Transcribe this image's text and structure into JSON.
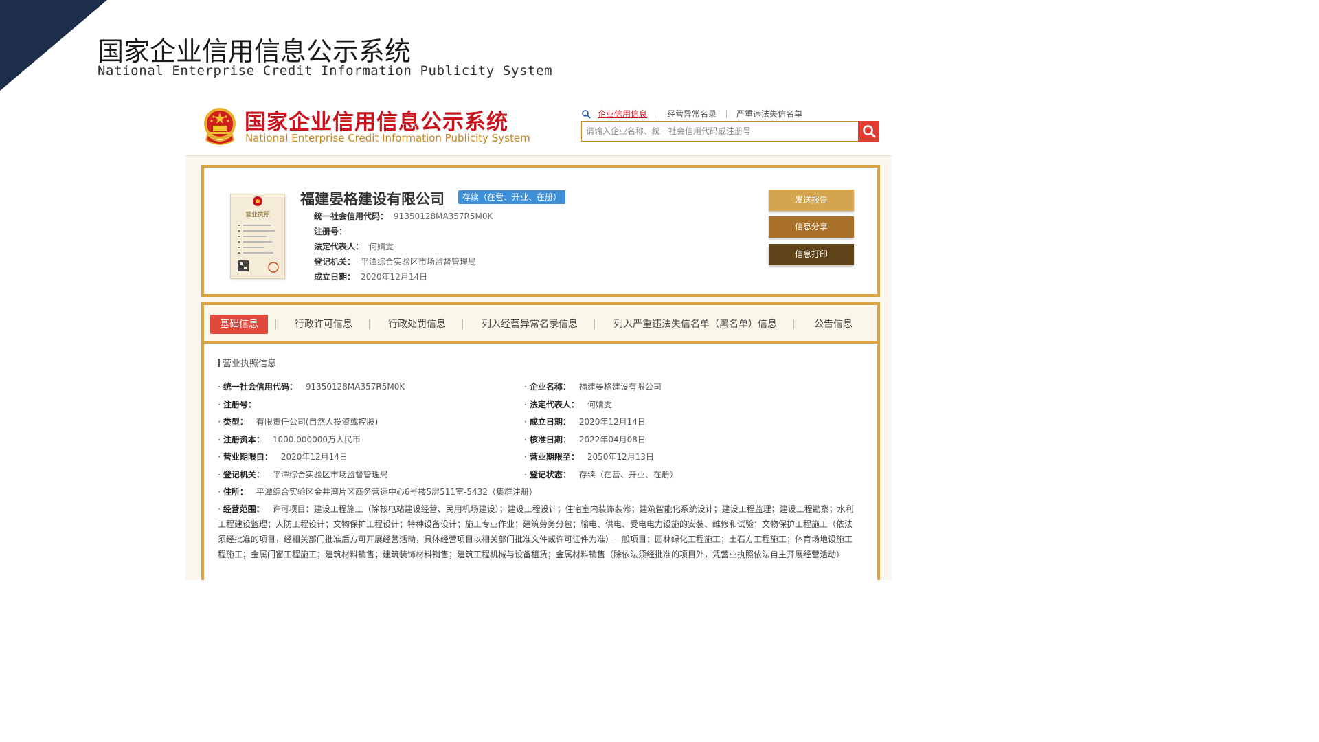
{
  "slide": {
    "title": "国家企业信用信息公示系统",
    "subtitle": "National Enterprise Credit Information Publicity System",
    "corner_color": "#1c2e4a"
  },
  "site": {
    "title": "国家企业信用信息公示系统",
    "title_en": "National Enterprise Credit Information Publicity System",
    "search_tabs": [
      "企业信用信息",
      "经营异常名录",
      "严重违法失信名单"
    ],
    "search_placeholder": "请输入企业名称、统一社会信用代码或注册号",
    "icons": {
      "emblem": "national-emblem-icon",
      "search": "search-icon"
    },
    "colors": {
      "brand_red": "#c8141e",
      "gold": "#d9a441",
      "search_btn": "#e03c31"
    }
  },
  "company": {
    "name": "福建晏格建设有限公司",
    "status": "存续（在营、开业、在册）",
    "basic": [
      {
        "label": "统一社会信用代码：",
        "value": "91350128MA357R5M0K"
      },
      {
        "label": "注册号：",
        "value": ""
      },
      {
        "label": "法定代表人：",
        "value": "何婧雯"
      },
      {
        "label": "登记机关：",
        "value": "平潭综合实验区市场监督管理局"
      },
      {
        "label": "成立日期：",
        "value": "2020年12月14日"
      }
    ],
    "actions": {
      "report": "发送报告",
      "share": "信息分享",
      "print": "信息打印"
    },
    "license_thumb_title": "营业执照"
  },
  "detail": {
    "tabs": [
      "基础信息",
      "行政许可信息",
      "行政处罚信息",
      "列入经营异常名录信息",
      "列入严重违法失信名单（黑名单）信息",
      "公告信息"
    ],
    "section_title": "营业执照信息",
    "left": [
      {
        "label": "统一社会信用代码：",
        "value": "91350128MA357R5M0K"
      },
      {
        "label": "注册号：",
        "value": ""
      },
      {
        "label": "类型：",
        "value": "有限责任公司(自然人投资或控股)"
      },
      {
        "label": "注册资本：",
        "value": "1000.000000万人民币"
      },
      {
        "label": "营业期限自：",
        "value": "2020年12月14日"
      },
      {
        "label": "登记机关：",
        "value": "平潭综合实验区市场监督管理局"
      }
    ],
    "right": [
      {
        "label": "企业名称：",
        "value": "福建晏格建设有限公司"
      },
      {
        "label": "法定代表人：",
        "value": "何婧雯"
      },
      {
        "label": "成立日期：",
        "value": "2020年12月14日"
      },
      {
        "label": "核准日期：",
        "value": "2022年04月08日"
      },
      {
        "label": "营业期限至：",
        "value": "2050年12月13日"
      },
      {
        "label": "登记状态：",
        "value": "存续（在营、开业、在册）"
      }
    ],
    "address": {
      "label": "住所：",
      "value": "平潭综合实验区金井湾片区商务营运中心6号楼5层511室-5432（集群注册）"
    },
    "scope": {
      "label": "经营范围：",
      "value": "许可项目：建设工程施工（除核电站建设经营、民用机场建设）；建设工程设计；住宅室内装饰装修；建筑智能化系统设计；建设工程监理；建设工程勘察；水利工程建设监理；人防工程设计；文物保护工程设计；特种设备设计；施工专业作业；建筑劳务分包；输电、供电、受电电力设施的安装、维修和试验；文物保护工程施工（依法须经批准的项目，经相关部门批准后方可开展经营活动，具体经营项目以相关部门批准文件或许可证件为准）一般项目：园林绿化工程施工；土石方工程施工；体育场地设施工程施工；金属门窗工程施工；建筑材料销售；建筑装饰材料销售；建筑工程机械与设备租赁；金属材料销售（除依法须经批准的项目外，凭营业执照依法自主开展经营活动）"
    }
  }
}
